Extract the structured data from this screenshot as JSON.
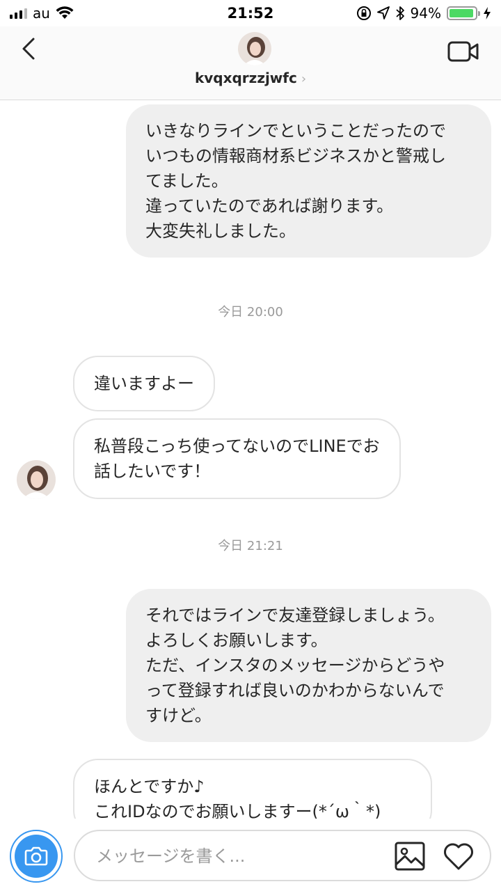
{
  "status_bar": {
    "carrier": "au",
    "time": "21:52",
    "battery_percent": "94%",
    "battery_level": 0.94
  },
  "header": {
    "username": "kvqxqrzzjwfc",
    "chevron": "›",
    "back_icon": "chevron-left-icon",
    "video_icon": "video-camera-icon"
  },
  "messages": [
    {
      "direction": "sent",
      "text": "いきなりラインでということだったので\nいつもの情報商材系ビジネスかと警戒し\nてました。\n違っていたのであれば謝ります。\n大変失礼しました。"
    },
    {
      "direction": "timestamp",
      "text": "今日 20:00"
    },
    {
      "direction": "received",
      "text": "違いますよー"
    },
    {
      "direction": "received",
      "text": "私普段こっち使ってないのでLINEでお\n話したいです！"
    },
    {
      "direction": "timestamp",
      "text": "今日 21:21"
    },
    {
      "direction": "sent",
      "text": "それではラインで友達登録しましょう。\nよろしくお願いします。\nただ、インスタのメッセージからどうや\nって登録すれば良いのかわからないんで\nすけど。"
    },
    {
      "direction": "received",
      "text": "ほんとですか♪\nこれIDなのでお願いしますー(*´ω｀*)"
    }
  ],
  "composer": {
    "placeholder": "メッセージを書く...",
    "camera_icon": "camera-icon",
    "gallery_icon": "image-icon",
    "like_icon": "heart-icon"
  },
  "colors": {
    "accent": "#3897f0",
    "sent_bubble": "#efefef",
    "received_border": "#e3e3e3",
    "battery": "#4cd964"
  }
}
